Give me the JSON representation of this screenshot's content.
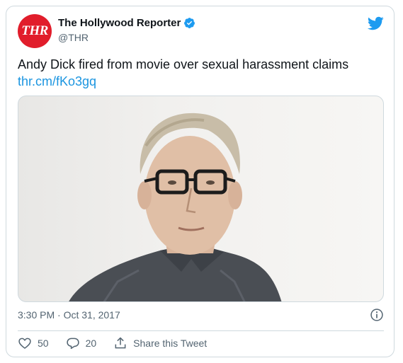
{
  "account": {
    "avatar_text": "THR",
    "name": "The Hollywood Reporter",
    "handle": "@THR",
    "brand_color": "#e11d2b"
  },
  "tweet": {
    "text": "Andy Dick fired from movie over sexual harassment claims",
    "link": "thr.cm/fKo3gq",
    "timestamp": "3:30 PM · Oct 31, 2017"
  },
  "media": {
    "icon": "photo-of-man-with-glasses"
  },
  "actions": {
    "likes": "50",
    "replies": "20",
    "share_label": "Share this Tweet"
  },
  "colors": {
    "link": "#1b95e0",
    "twitter_blue": "#1d9bf0",
    "secondary_text": "#536471"
  }
}
